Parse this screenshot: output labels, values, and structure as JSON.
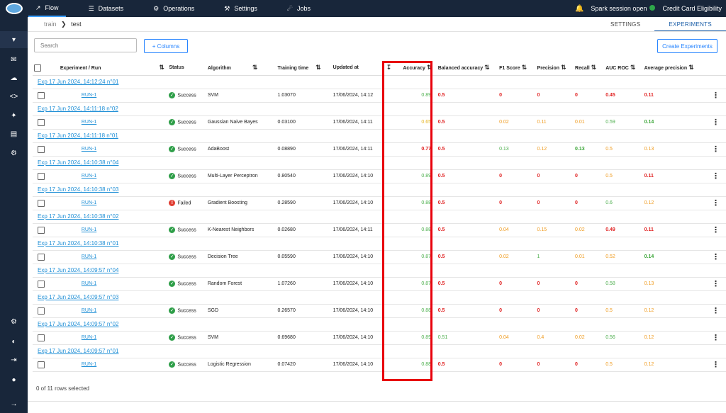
{
  "topnav": [
    {
      "icon": "flow-icon",
      "glyph": "↗",
      "label": "Flow"
    },
    {
      "icon": "datasets-icon",
      "glyph": "☰",
      "label": "Datasets"
    },
    {
      "icon": "operations-icon",
      "glyph": "⚙",
      "label": "Operations"
    },
    {
      "icon": "settings-icon",
      "glyph": "⚒",
      "label": "Settings"
    },
    {
      "icon": "jobs-icon",
      "glyph": "☄",
      "label": "Jobs"
    }
  ],
  "spark_status": "Spark session open",
  "project_name": "Credit Card Eligibility",
  "breadcrumb": {
    "parent": "train",
    "current": "test"
  },
  "tabs": [
    "SETTINGS",
    "EXPERIMENTS"
  ],
  "search_placeholder": "Search",
  "columns_button": "+ Columns",
  "create_button": "Create Experiments",
  "headers": {
    "experiment": "Experiment / Run",
    "status": "Status",
    "algorithm": "Algorithm",
    "training_time": "Training time",
    "updated_at": "Updated at",
    "accuracy": "Accuracy",
    "balanced_accuracy": "Balanced accuracy",
    "f1": "F1 Score",
    "precision": "Precision",
    "recall": "Recall",
    "auc": "AUC ROC",
    "avg_precision": "Average precision"
  },
  "rows": [
    {
      "exp": "Exp 17 Jun 2024, 14:12:24 n°01",
      "run": "RUN-1",
      "status": "Success",
      "ok": true,
      "algo": "SVM",
      "time": "1.03070",
      "updated": "17/06/2024, 14:12",
      "acc": "0.89",
      "bal": "0.5",
      "f1": "0",
      "prec": "0",
      "rec": "0",
      "auc": "0.45",
      "ap": "0.11"
    },
    {
      "exp": "Exp 17 Jun 2024, 14:11:18 n°02",
      "run": "RUN-1",
      "status": "Success",
      "ok": true,
      "algo": "Gaussian Naive Bayes",
      "time": "0.03100",
      "updated": "17/06/2024, 14:11",
      "acc": "0.65",
      "bal": "0.5",
      "f1": "0.02",
      "prec": "0.11",
      "rec": "0.01",
      "auc": "0.59",
      "ap": "0.14"
    },
    {
      "exp": "Exp 17 Jun 2024, 14:11:18 n°01",
      "run": "RUN-1",
      "status": "Success",
      "ok": true,
      "algo": "AdaBoost",
      "time": "0.08890",
      "updated": "17/06/2024, 14:11",
      "acc": "0.77",
      "bal": "0.5",
      "f1": "0.13",
      "prec": "0.12",
      "rec": "0.13",
      "auc": "0.5",
      "ap": "0.13"
    },
    {
      "exp": "Exp 17 Jun 2024, 14:10:38 n°04",
      "run": "RUN-1",
      "status": "Success",
      "ok": true,
      "algo": "Multi-Layer Perceptron",
      "time": "0.80540",
      "updated": "17/06/2024, 14:10",
      "acc": "0.89",
      "bal": "0.5",
      "f1": "0",
      "prec": "0",
      "rec": "0",
      "auc": "0.5",
      "ap": "0.11"
    },
    {
      "exp": "Exp 17 Jun 2024, 14:10:38 n°03",
      "run": "RUN-1",
      "status": "Failed",
      "ok": false,
      "algo": "Gradient Boosting",
      "time": "0.28590",
      "updated": "17/06/2024, 14:10",
      "acc": "0.88",
      "bal": "0.5",
      "f1": "0",
      "prec": "0",
      "rec": "0",
      "auc": "0.6",
      "ap": "0.12"
    },
    {
      "exp": "Exp 17 Jun 2024, 14:10:38 n°02",
      "run": "RUN-1",
      "status": "Success",
      "ok": true,
      "algo": "K-Nearest Neighbors",
      "time": "0.02680",
      "updated": "17/06/2024, 14:11",
      "acc": "0.88",
      "bal": "0.5",
      "f1": "0.04",
      "prec": "0.15",
      "rec": "0.02",
      "auc": "0.49",
      "ap": "0.11"
    },
    {
      "exp": "Exp 17 Jun 2024, 14:10:38 n°01",
      "run": "RUN-1",
      "status": "Success",
      "ok": true,
      "algo": "Decision Tree",
      "time": "0.05590",
      "updated": "17/06/2024, 14:10",
      "acc": "0.87",
      "bal": "0.5",
      "f1": "0.02",
      "prec": "1",
      "rec": "0.01",
      "auc": "0.52",
      "ap": "0.14"
    },
    {
      "exp": "Exp 17 Jun 2024, 14:09:57 n°04",
      "run": "RUN-1",
      "status": "Success",
      "ok": true,
      "algo": "Random Forest",
      "time": "1.07260",
      "updated": "17/06/2024, 14:10",
      "acc": "0.87",
      "bal": "0.5",
      "f1": "0",
      "prec": "0",
      "rec": "0",
      "auc": "0.58",
      "ap": "0.13"
    },
    {
      "exp": "Exp 17 Jun 2024, 14:09:57 n°03",
      "run": "RUN-1",
      "status": "Success",
      "ok": true,
      "algo": "SGD",
      "time": "0.26570",
      "updated": "17/06/2024, 14:10",
      "acc": "0.88",
      "bal": "0.5",
      "f1": "0",
      "prec": "0",
      "rec": "0",
      "auc": "0.5",
      "ap": "0.12"
    },
    {
      "exp": "Exp 17 Jun 2024, 14:09:57 n°02",
      "run": "RUN-1",
      "status": "Success",
      "ok": true,
      "algo": "SVM",
      "time": "0.69680",
      "updated": "17/06/2024, 14:10",
      "acc": "0.89",
      "bal": "0.51",
      "f1": "0.04",
      "prec": "0.4",
      "rec": "0.02",
      "auc": "0.56",
      "ap": "0.12"
    },
    {
      "exp": "Exp 17 Jun 2024, 14:09:57 n°01",
      "run": "RUN-1",
      "status": "Success",
      "ok": true,
      "algo": "Logistic Regression",
      "time": "0.07420",
      "updated": "17/06/2024, 14:10",
      "acc": "0.88",
      "bal": "0.5",
      "f1": "0",
      "prec": "0",
      "rec": "0",
      "auc": "0.5",
      "ap": "0.12"
    }
  ],
  "footer_text": "0 of 11 rows selected",
  "colors": {
    "nav_bg": "#18263a",
    "accent": "#2684ff",
    "highlight": "#e8000b",
    "success": "#2e9e48",
    "failed": "#e03c31"
  }
}
